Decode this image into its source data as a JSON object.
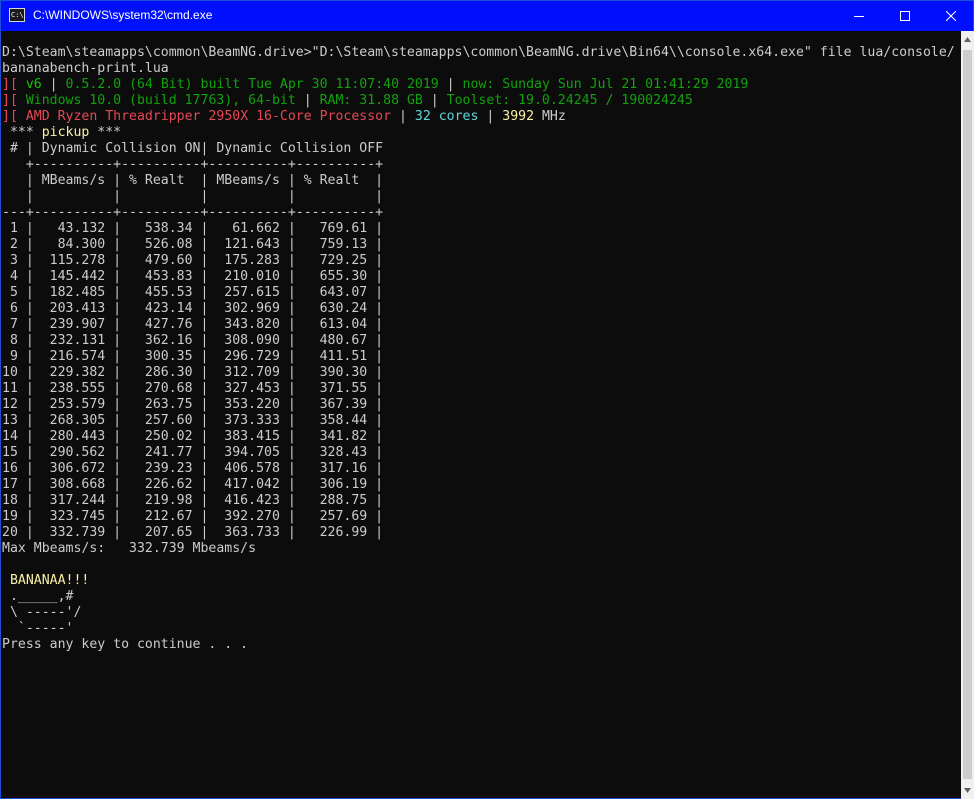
{
  "window": {
    "title": "C:\\WINDOWS\\system32\\cmd.exe",
    "icon_text": "C:\\",
    "colors": {
      "titlebar": "#0010ff",
      "background": "#0c0c0c",
      "text": "#cccccc"
    }
  },
  "console": {
    "lines": [
      [
        {
          "text": "D:\\Steam\\steamapps\\common\\BeamNG.drive>\"D:\\Steam\\steamapps\\common\\BeamNG.drive\\Bin64\\\\console.x64.exe\" file lua/console/",
          "color": "#cccccc"
        }
      ],
      [
        {
          "text": "bananabench-print.lua",
          "color": "#cccccc"
        }
      ],
      [
        {
          "text": "][ ",
          "color": "#e74856"
        },
        {
          "text": "v6",
          "color": "#16c60c"
        },
        {
          "text": " | ",
          "color": "#cccccc"
        },
        {
          "text": "0.5.2.0 (64 Bit) built Tue Apr 30 11:07:40 2019",
          "color": "#13a10e"
        },
        {
          "text": " | ",
          "color": "#cccccc"
        },
        {
          "text": "now: Sunday Sun Jul 21 01:41:29 2019",
          "color": "#13a10e"
        }
      ],
      [
        {
          "text": "][ ",
          "color": "#e74856"
        },
        {
          "text": "Windows 10.0 (build 17763), 64-bit",
          "color": "#13a10e"
        },
        {
          "text": " | ",
          "color": "#cccccc"
        },
        {
          "text": "RAM: 31.88 GB",
          "color": "#13a10e"
        },
        {
          "text": " | ",
          "color": "#cccccc"
        },
        {
          "text": "Toolset: 19.0.24245 / 190024245",
          "color": "#13a10e"
        }
      ],
      [
        {
          "text": "][ ",
          "color": "#e74856"
        },
        {
          "text": "AMD Ryzen Threadripper 2950X 16-Core Processor",
          "color": "#e74856"
        },
        {
          "text": " | ",
          "color": "#cccccc"
        },
        {
          "text": "32 cores",
          "color": "#61d6d6"
        },
        {
          "text": " | ",
          "color": "#cccccc"
        },
        {
          "text": "3992",
          "color": "#f9f1a5"
        },
        {
          "text": " MHz",
          "color": "#cccccc"
        }
      ],
      [
        {
          "text": " *** ",
          "color": "#cccccc"
        },
        {
          "text": "pickup",
          "color": "#f9f1a5"
        },
        {
          "text": " ***",
          "color": "#cccccc"
        }
      ],
      [
        {
          "text": " # | Dynamic Collision ON| Dynamic Collision OFF",
          "color": "#cccccc"
        }
      ],
      [
        {
          "text": "   +----------+----------+----------+----------+",
          "color": "#cccccc"
        }
      ],
      [
        {
          "text": "   | MBeams/s | % Realt  | MBeams/s | % Realt  |",
          "color": "#cccccc"
        }
      ],
      [
        {
          "text": "   |          |          |          |          |",
          "color": "#cccccc"
        }
      ],
      [
        {
          "text": "---+----------+----------+----------+----------+",
          "color": "#cccccc"
        }
      ],
      [
        {
          "text": " 1 |   43.132 |   538.34 |   61.662 |   769.61 |",
          "color": "#cccccc"
        }
      ],
      [
        {
          "text": " 2 |   84.300 |   526.08 |  121.643 |   759.13 |",
          "color": "#cccccc"
        }
      ],
      [
        {
          "text": " 3 |  115.278 |   479.60 |  175.283 |   729.25 |",
          "color": "#cccccc"
        }
      ],
      [
        {
          "text": " 4 |  145.442 |   453.83 |  210.010 |   655.30 |",
          "color": "#cccccc"
        }
      ],
      [
        {
          "text": " 5 |  182.485 |   455.53 |  257.615 |   643.07 |",
          "color": "#cccccc"
        }
      ],
      [
        {
          "text": " 6 |  203.413 |   423.14 |  302.969 |   630.24 |",
          "color": "#cccccc"
        }
      ],
      [
        {
          "text": " 7 |  239.907 |   427.76 |  343.820 |   613.04 |",
          "color": "#cccccc"
        }
      ],
      [
        {
          "text": " 8 |  232.131 |   362.16 |  308.090 |   480.67 |",
          "color": "#cccccc"
        }
      ],
      [
        {
          "text": " 9 |  216.574 |   300.35 |  296.729 |   411.51 |",
          "color": "#cccccc"
        }
      ],
      [
        {
          "text": "10 |  229.382 |   286.30 |  312.709 |   390.30 |",
          "color": "#cccccc"
        }
      ],
      [
        {
          "text": "11 |  238.555 |   270.68 |  327.453 |   371.55 |",
          "color": "#cccccc"
        }
      ],
      [
        {
          "text": "12 |  253.579 |   263.75 |  353.220 |   367.39 |",
          "color": "#cccccc"
        }
      ],
      [
        {
          "text": "13 |  268.305 |   257.60 |  373.333 |   358.44 |",
          "color": "#cccccc"
        }
      ],
      [
        {
          "text": "14 |  280.443 |   250.02 |  383.415 |   341.82 |",
          "color": "#cccccc"
        }
      ],
      [
        {
          "text": "15 |  290.562 |   241.77 |  394.705 |   328.43 |",
          "color": "#cccccc"
        }
      ],
      [
        {
          "text": "16 |  306.672 |   239.23 |  406.578 |   317.16 |",
          "color": "#cccccc"
        }
      ],
      [
        {
          "text": "17 |  308.668 |   226.62 |  417.042 |   306.19 |",
          "color": "#cccccc"
        }
      ],
      [
        {
          "text": "18 |  317.244 |   219.98 |  416.423 |   288.75 |",
          "color": "#cccccc"
        }
      ],
      [
        {
          "text": "19 |  323.745 |   212.67 |  392.270 |   257.69 |",
          "color": "#cccccc"
        }
      ],
      [
        {
          "text": "20 |  332.739 |   207.65 |  363.733 |   226.99 |",
          "color": "#cccccc"
        }
      ],
      [
        {
          "text": "Max Mbeams/s:   332.739 Mbeams/s",
          "color": "#cccccc"
        }
      ],
      [
        {
          "text": "",
          "color": "#cccccc"
        }
      ],
      [
        {
          "text": " BANANAA!!!",
          "color": "#f9f1a5"
        }
      ],
      [
        {
          "text": " ._____,#",
          "color": "#cccccc"
        }
      ],
      [
        {
          "text": " \\ -----'/",
          "color": "#cccccc"
        }
      ],
      [
        {
          "text": "  `-----'",
          "color": "#cccccc"
        }
      ],
      [
        {
          "text": "Press any key to continue . . .",
          "color": "#cccccc"
        }
      ]
    ]
  }
}
